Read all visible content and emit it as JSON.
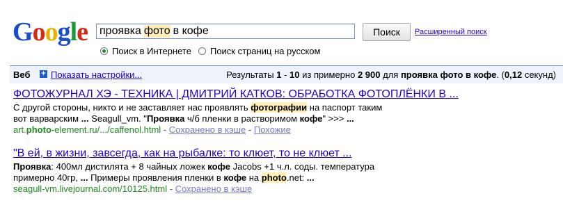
{
  "logo": {
    "text": "Google",
    "letters": [
      {
        "ch": "G",
        "color": "#1b4dc6"
      },
      {
        "ch": "o",
        "color": "#d42b16"
      },
      {
        "ch": "o",
        "color": "#e8b200"
      },
      {
        "ch": "g",
        "color": "#1b4dc6"
      },
      {
        "ch": "l",
        "color": "#199a3a"
      },
      {
        "ch": "e",
        "color": "#d42b16"
      }
    ]
  },
  "search": {
    "query_parts": [
      "проявка",
      "фото",
      "в кофе"
    ],
    "button_label": "Поиск",
    "advanced_link": "Расширенный поиск",
    "options": [
      "Поиск в Интернете",
      "Поиск страниц на русском"
    ],
    "selected_option": 0
  },
  "results_bar": {
    "tab_label": "Веб",
    "settings_link": "Показать настройки...",
    "stats_prefix": "Результаты",
    "range_start": "1",
    "range_dash": "-",
    "range_end": "10",
    "stats_mid": "из примерно",
    "count": "2 900",
    "stats_for": "для",
    "query": "проявка фото в кофе",
    "time_open": ". (",
    "time": "0,12",
    "time_close": "секунд)"
  },
  "results": [
    {
      "title": "ФОТОЖУРНАЛ ХЭ - ТЕХНИКА | ДМИТРИЙ КАТКОВ: ОБРАБОТКА ФОТОПЛЁНКИ В ...",
      "snippet_lines": [
        [
          {
            "t": "С другой стороны, никто и не заставляет нас проявлять "
          },
          {
            "t": "фотографии",
            "hl": true
          },
          {
            "t": " на паспорт таким"
          }
        ],
        [
          {
            "t": "вот варварским "
          },
          {
            "t": "...",
            "b": true
          },
          {
            "t": " Seagull_vm. \""
          },
          {
            "t": "Проявка",
            "b": true
          },
          {
            "t": " ч/б пленки в растворимом "
          },
          {
            "t": "кофе",
            "b": true
          },
          {
            "t": "\" >>> "
          },
          {
            "t": "...",
            "b": true
          }
        ]
      ],
      "url_parts": [
        {
          "t": "art."
        },
        {
          "t": "photo",
          "b": true
        },
        {
          "t": "-element.ru/.../caffenol.html"
        }
      ],
      "cache_link": "Сохранено в кэше",
      "similar_link": "Похожие",
      "separator": " - "
    },
    {
      "title": "\"В ей, в жизни, завсегда, как на рыбалке: то клюет, то не клюет ...",
      "snippet_lines": [
        [
          {
            "t": "Проявка",
            "b": true
          },
          {
            "t": ": 400мл дистилята + 8 чайных ложек "
          },
          {
            "t": "кофе",
            "b": true
          },
          {
            "t": " Jacobs +1 ч.л. соды. температура"
          }
        ],
        [
          {
            "t": "примерно 40гр, "
          },
          {
            "t": "...",
            "b": true
          },
          {
            "t": " Примеры проявления пленки в "
          },
          {
            "t": "кофе",
            "b": true
          },
          {
            "t": " на "
          },
          {
            "t": "photo",
            "hl": true
          },
          {
            "t": ".net: "
          },
          {
            "t": "...",
            "b": true
          }
        ]
      ],
      "url_parts": [
        {
          "t": "seagull-vm.livejournal.com/10125.html"
        }
      ],
      "cache_link": "Сохранено в кэше",
      "separator": " - "
    }
  ]
}
